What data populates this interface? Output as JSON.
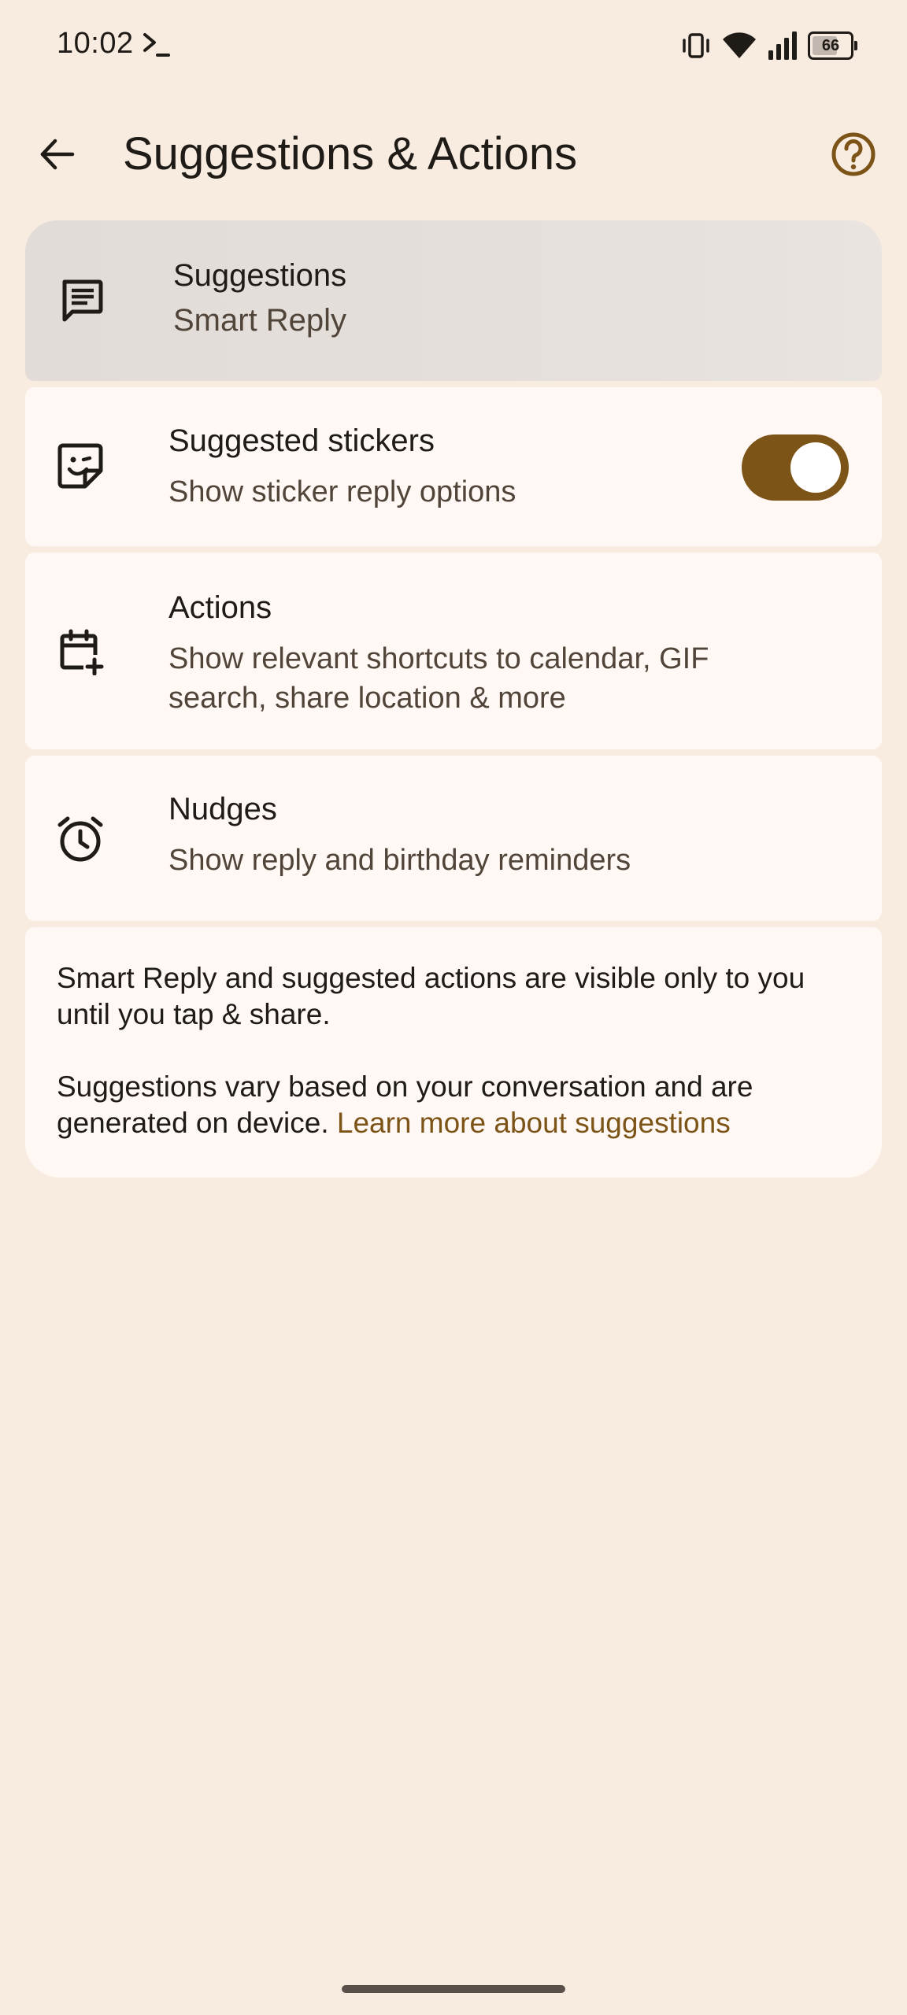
{
  "status_bar": {
    "time": "10:02",
    "battery_level": "66",
    "icons": [
      "terminal-icon",
      "vibrate-icon",
      "wifi-icon",
      "signal-icon",
      "battery-icon"
    ]
  },
  "app_bar": {
    "title": "Suggestions & Actions",
    "back_icon": "arrow-back-icon",
    "help_icon": "help-circle-icon"
  },
  "settings": {
    "suggestions": {
      "title": "Suggestions",
      "subtitle": "Smart Reply",
      "icon": "message-icon"
    },
    "suggested_stickers": {
      "title": "Suggested stickers",
      "subtitle": "Show sticker reply options",
      "icon": "sticker-icon",
      "enabled": true
    },
    "actions": {
      "title": "Actions",
      "subtitle": "Show relevant shortcuts to calendar, GIF search, share location & more",
      "icon": "calendar-add-icon"
    },
    "nudges": {
      "title": "Nudges",
      "subtitle": "Show reply and birthday reminders",
      "icon": "alarm-icon"
    }
  },
  "info": {
    "paragraph1": "Smart Reply and suggested actions are visible only to you until you tap & share.",
    "paragraph2_prefix": "Suggestions vary based on your conversation and are generated on device.",
    "paragraph2_link": "Learn more about suggestions"
  },
  "colors": {
    "background": "#f8ebe0",
    "card": "#fff8f4",
    "accent": "#7d5418",
    "text_primary": "#1f1b17",
    "text_secondary": "#51453a"
  }
}
